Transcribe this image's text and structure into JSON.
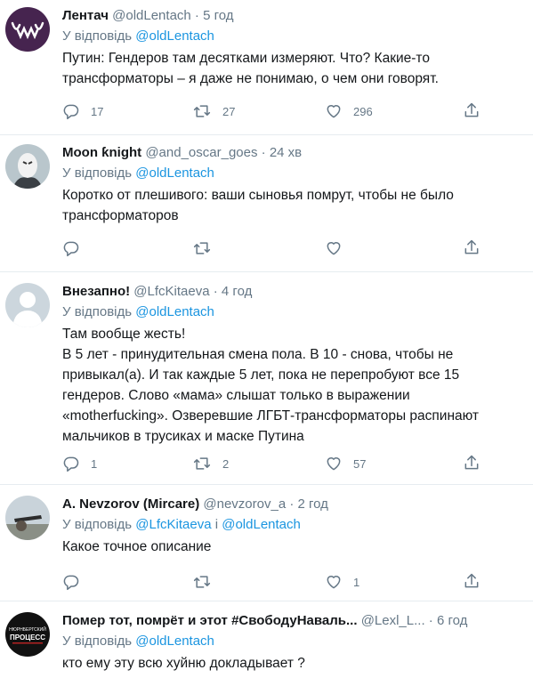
{
  "tweets": [
    {
      "name": "Лентач",
      "handle": "@oldLentach",
      "time": "5 год",
      "reply_prefix": "У відповідь",
      "reply_mentions": [
        "@oldLentach"
      ],
      "reply_joiner": "",
      "text": [
        "Путин: Гендеров там десятками измеряют. Что? Какие-то",
        "трансформаторы – я даже не понимаю, о чем они говорят."
      ],
      "counts": {
        "replies": "17",
        "retweets": "27",
        "likes": "296"
      }
    },
    {
      "name": "Moon ƙnight",
      "handle": "@and_oscar_goes",
      "time": "24 хв",
      "reply_prefix": "У відповідь",
      "reply_mentions": [
        "@oldLentach"
      ],
      "reply_joiner": "",
      "text": [
        "Коротко от плешивого: ваши сыновья помрут, чтобы не было",
        "трансформаторов"
      ],
      "counts": {
        "replies": "",
        "retweets": "",
        "likes": ""
      }
    },
    {
      "name": "Внезапно!",
      "handle": "@LfcKitaeva",
      "time": "4 год",
      "reply_prefix": "У відповідь",
      "reply_mentions": [
        "@oldLentach"
      ],
      "reply_joiner": "",
      "text": [
        "Там вообще жесть!",
        "В 5 лет - принудительная смена пола. В 10 - снова, чтобы не",
        "привыкал(а). И так каждые 5 лет, пока не перепробуют все 15",
        "гендеров. Слово «мама» слышат только в выражении",
        "«motherfucking». Озверевшие ЛГБТ-трансформаторы распинают",
        "мальчиков в трусиках и маске Путина"
      ],
      "counts": {
        "replies": "1",
        "retweets": "2",
        "likes": "57"
      }
    },
    {
      "name": "A. Nevzorov (Mircare)",
      "handle": "@nevzorov_a",
      "time": "2 год",
      "reply_prefix": "У відповідь",
      "reply_mentions": [
        "@LfcKitaeva",
        "@oldLentach"
      ],
      "reply_joiner": "і",
      "text": [
        "Какое точное описание"
      ],
      "counts": {
        "replies": "",
        "retweets": "",
        "likes": "1"
      }
    },
    {
      "name": "Помер тот, помрёт и этот #СвободуНаваль...",
      "handle": "@Lexl_L...",
      "time": "6 год",
      "reply_prefix": "У відповідь",
      "reply_mentions": [
        "@oldLentach"
      ],
      "reply_joiner": "",
      "text": [
        "кто ему эту всю хуйню докладывает ?"
      ],
      "counts": {
        "replies": "",
        "retweets": "",
        "likes": ""
      }
    }
  ],
  "avatar_5_text": [
    "НЮРНБЕРГСКИЙ",
    "ПРОЦЕСС"
  ],
  "dot": "·",
  "colors": {
    "link": "#1b95e0",
    "muted": "#657786",
    "border": "#e6ecf0"
  },
  "icons": [
    "reply-icon",
    "retweet-icon",
    "like-icon",
    "share-icon"
  ]
}
